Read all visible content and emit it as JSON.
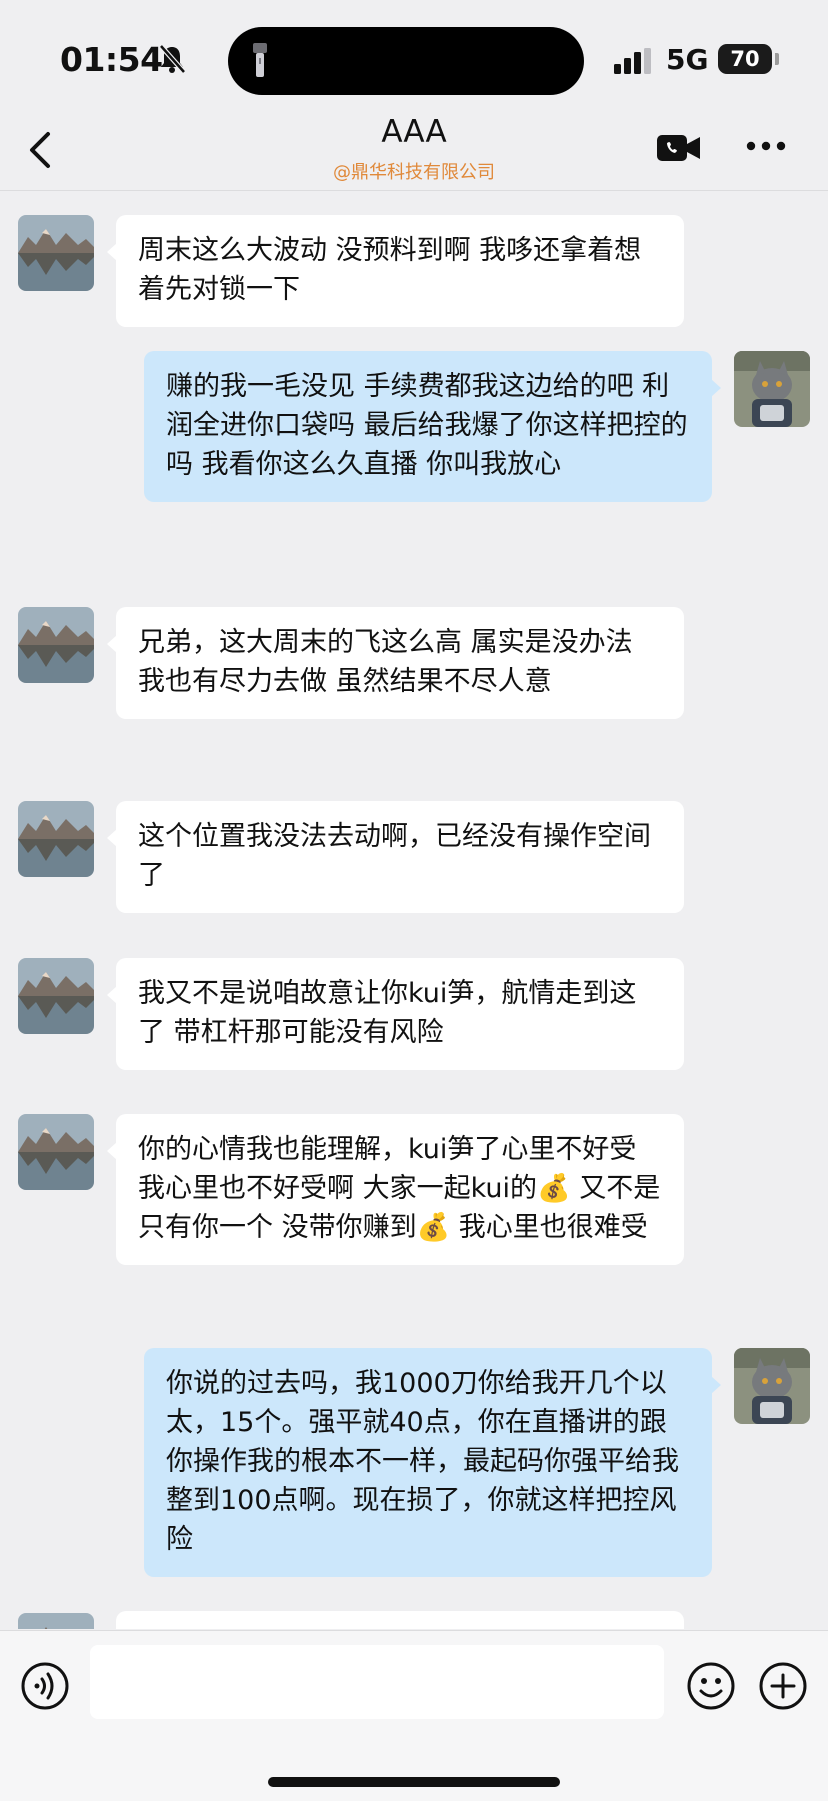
{
  "status_bar": {
    "time": "01:54",
    "network": "5G",
    "battery": "70"
  },
  "header": {
    "title": "AAA",
    "subtitle": "@鼎华科技有限公司"
  },
  "messages": [
    {
      "side": "left",
      "text": "周末这么大波动 没预料到啊 我哆还拿着想着先对锁一下"
    },
    {
      "side": "right",
      "text": "赚的我一毛没见 手续费都我这边给的吧  利润全进你口袋吗 最后给我爆了你这样把控的吗 我看你这么久直播 你叫我放心"
    },
    {
      "side": "left",
      "text": "兄弟，这大周末的飞这么高 属实是没办法 我也有尽力去做 虽然结果不尽人意"
    },
    {
      "side": "left",
      "text": "这个位置我没法去动啊，已经没有操作空间了"
    },
    {
      "side": "left",
      "text": "我又不是说咱故意让你kui笋，航情走到这了 带杠杆那可能没有风险"
    },
    {
      "side": "left",
      "text": "你的心情我也能理解，kui笋了心里不好受 我心里也不好受啊 大家一起kui的💰 又不是只有你一个 没带你赚到💰 我心里也很难受"
    },
    {
      "side": "right",
      "text": "你说的过去吗，我1000刀你给我开几个以太，15个。强平就40点，你在直播讲的跟你操作我的根本不一样，最起码你强平给我整到100点啊。现在损了，你就这样把控风险"
    }
  ],
  "input": {
    "value": "",
    "placeholder": ""
  },
  "colors": {
    "background": "#efeff1",
    "incoming_bubble": "#ffffff",
    "outgoing_bubble": "#cce7fb",
    "subtitle": "#e0893a"
  },
  "icons": {
    "back": "chevron-left-icon",
    "video_call": "video-camera-icon",
    "more": "ellipsis-icon",
    "voice": "voice-input-icon",
    "emoji": "smiley-icon",
    "plus": "plus-icon"
  }
}
